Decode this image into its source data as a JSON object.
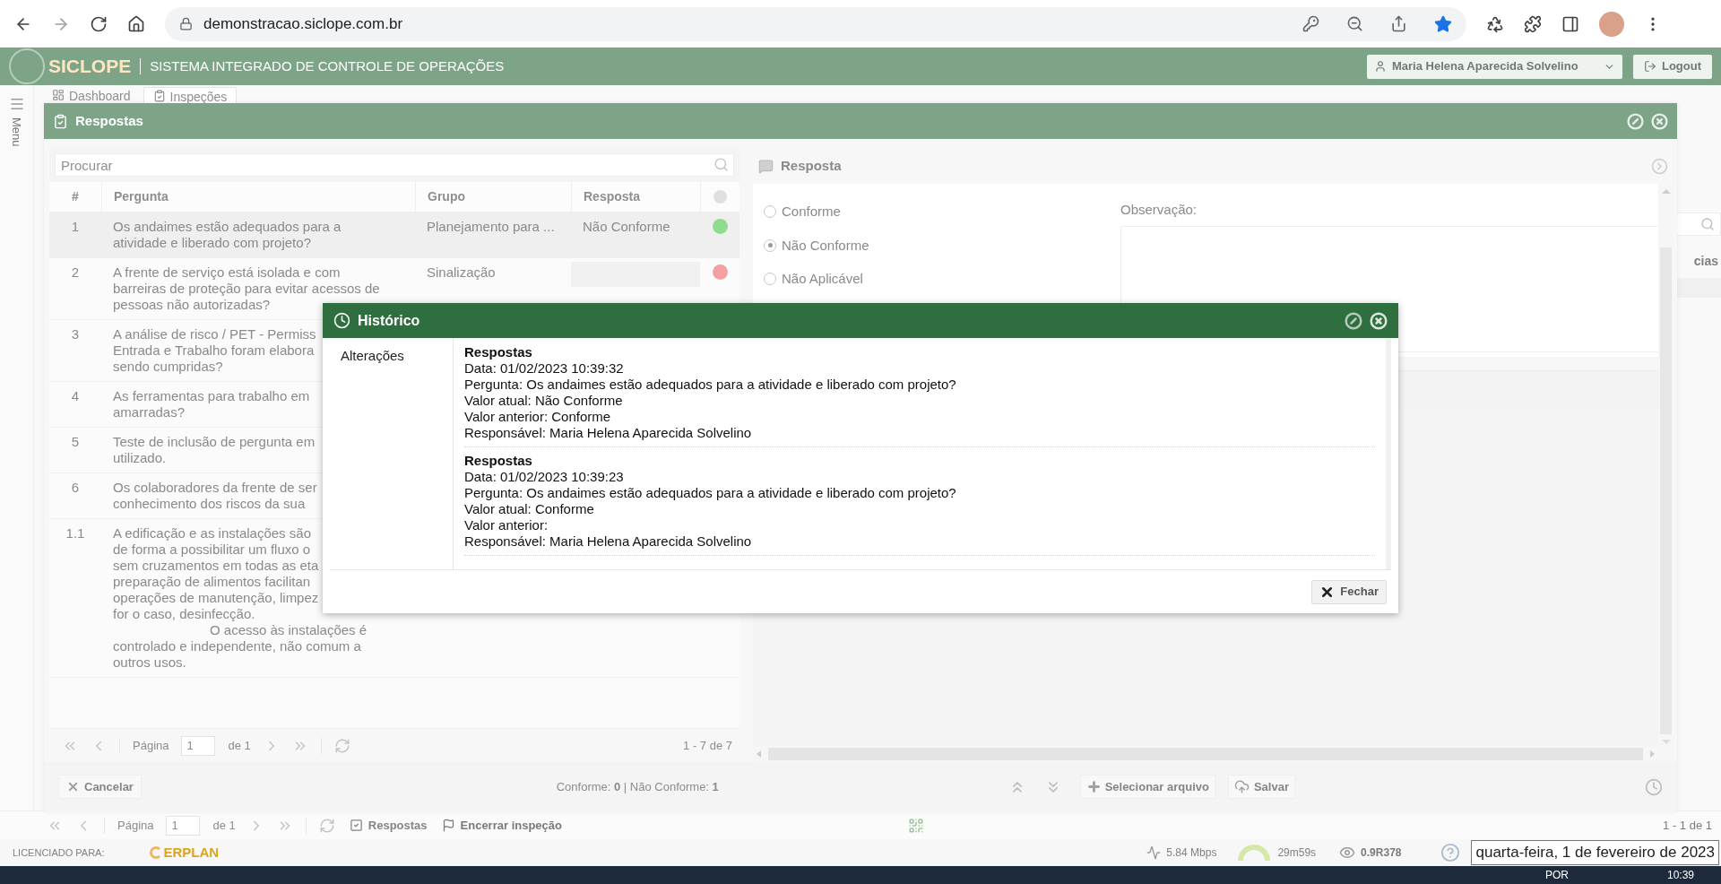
{
  "browser": {
    "url": "demonstracao.siclope.com.br"
  },
  "app_header": {
    "logo": "SICLOPE",
    "title": "SISTEMA INTEGRADO DE CONTROLE DE OPERAÇÕES",
    "user": "Maria Helena Aparecida Solvelino",
    "logout": "Logout"
  },
  "tabs": [
    {
      "label": "Dashboard",
      "selected": false
    },
    {
      "label": "Inspeções",
      "selected": true
    }
  ],
  "sidebar": {
    "label": "Menu"
  },
  "background_list": {
    "column_3": "cias"
  },
  "respostas_modal": {
    "title": "Respostas",
    "search": {
      "placeholder": "Procurar"
    },
    "table": {
      "columns": [
        "#",
        "Pergunta",
        "Grupo",
        "Resposta"
      ],
      "rows": [
        {
          "number": "1",
          "lines": [
            "Os andaimes estão adequados para a",
            "atividade e liberado com projeto?"
          ],
          "group": "Planejamento para ...",
          "answer": "Não Conforme",
          "answered": true,
          "color": "#8fdc8f",
          "selected": true
        },
        {
          "number": "2",
          "lines": [
            "A frente de serviço está isolada e com",
            "barreiras de proteção para evitar acessos de",
            "pessoas não autorizadas?"
          ],
          "group": "Sinalização",
          "answered": false,
          "color": "#f3a0a0",
          "selected": false
        },
        {
          "number": "3",
          "lines": [
            "A análise de risco / PET - Permiss",
            "Entrada e Trabalho foram elabora",
            "sendo cumpridas?"
          ],
          "selected": false
        },
        {
          "number": "4",
          "lines": [
            "As ferramentas para trabalho em",
            "amarradas?"
          ],
          "selected": false
        },
        {
          "number": "5",
          "lines": [
            "Teste de inclusão de pergunta em",
            "utilizado."
          ],
          "selected": false
        },
        {
          "number": "6",
          "lines": [
            "Os colaboradores da frente de ser",
            "conhecimento dos riscos da sua"
          ],
          "selected": false
        },
        {
          "number": "1.1",
          "lines": [
            "A edificação e as instalações são",
            "de forma a possibilitar um fluxo o",
            "sem cruzamentos em todas as eta",
            "preparação de alimentos facilitan",
            "operações de manutenção, limpez",
            "for o caso, desinfecção."
          ],
          "note_lines": [
            "O acesso às instalações é",
            "controlado e independente, não comum a",
            "outros usos."
          ],
          "selected": false
        }
      ]
    },
    "pager": {
      "page_label": "Página",
      "page": "1",
      "page_of": "de 1",
      "range": "1 - 7 de 7"
    },
    "response_panel": {
      "title": "Resposta",
      "options": [
        {
          "label": "Conforme",
          "selected": false
        },
        {
          "label": "Não Conforme",
          "selected": true
        },
        {
          "label": "Não Aplicável",
          "selected": false
        }
      ],
      "observation_label": "Observação:"
    },
    "footer": {
      "cancel": "Cancelar",
      "summary": "Conforme: **0** | Não Conforme: **1**",
      "file_button": "Selecionar arquivo",
      "save": "Salvar"
    }
  },
  "historico_dialog": {
    "title": "Histórico",
    "section": "Alterações",
    "entries": [
      {
        "title": "Respostas",
        "lines": [
          "Data: 01/02/2023 10:39:32",
          "Pergunta: Os andaimes estão adequados para a atividade e liberado com projeto?",
          "Valor atual: Não Conforme",
          "Valor anterior: Conforme",
          "Responsável: Maria Helena Aparecida Solvelino"
        ]
      },
      {
        "title": "Respostas",
        "lines": [
          "Data: 01/02/2023 10:39:23",
          "Pergunta: Os andaimes estão adequados para a atividade e liberado com projeto?",
          "Valor atual: Conforme",
          "Valor anterior:",
          "Responsável: Maria Helena Aparecida Solvelino"
        ]
      }
    ],
    "close": "Fechar"
  },
  "bottom_bar": {
    "page_label": "Página",
    "page": "1",
    "page_of": "de 1",
    "respostas": "Respostas",
    "finish": "Encerrar inspeção",
    "range": "1 - 1 de 1"
  },
  "footer": {
    "licensed": "LICENCIADO PARA:",
    "brand": "ERPLAN",
    "speed": "5.84 Mbps",
    "timer": "29m59s",
    "version": "0.9R378",
    "tooltip": "quarta-feira, 1 de fevereiro de 2023"
  },
  "taskbar": {
    "language": "POR",
    "time": "10:39"
  }
}
